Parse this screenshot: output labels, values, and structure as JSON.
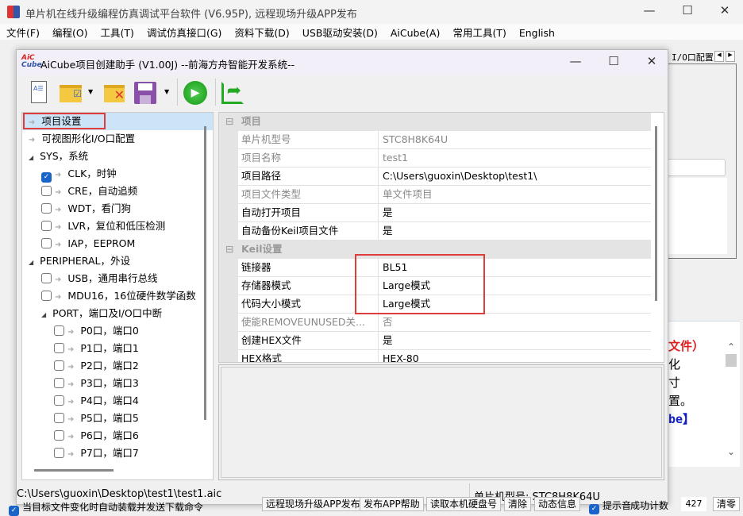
{
  "app": {
    "title": "单片机在线升级编程仿真调试平台软件 (V6.95P), 远程现场升级APP发布"
  },
  "menu": [
    "文件(F)",
    "编程(O)",
    "工具(T)",
    "调试仿真接口(G)",
    "资料下载(D)",
    "USB驱动安装(D)",
    "AiCube(A)",
    "常用工具(T)",
    "English"
  ],
  "right_panel": {
    "tab": "I/O口配置",
    "lines": [
      {
        "text": "文件）",
        "color": "#e02020"
      },
      {
        "text": "化",
        "color": "#000000"
      },
      {
        "text": "寸",
        "color": "#000000"
      },
      {
        "text": "置。",
        "color": "#000000"
      },
      {
        "text": "be】",
        "color": "#1020c0"
      }
    ]
  },
  "dialog": {
    "title": "AiCube项目创建助手 (V1.00J) --前海方舟智能开发系统--",
    "logo": "AiC Cube",
    "tree": [
      {
        "label": "项目设置",
        "level": 0,
        "kind": "leaf",
        "selected": true
      },
      {
        "label": "可视图形化I/O口配置",
        "level": 0,
        "kind": "leaf"
      },
      {
        "label": "SYS，系统",
        "level": 0,
        "kind": "group"
      },
      {
        "label": "CLK，时钟",
        "level": 1,
        "kind": "check",
        "checked": true
      },
      {
        "label": "CRE，自动追频",
        "level": 1,
        "kind": "check",
        "checked": false
      },
      {
        "label": "WDT，看门狗",
        "level": 1,
        "kind": "check",
        "checked": false
      },
      {
        "label": "LVR，复位和低压检测",
        "level": 1,
        "kind": "check",
        "checked": false
      },
      {
        "label": "IAP，EEPROM",
        "level": 1,
        "kind": "check",
        "checked": false
      },
      {
        "label": "PERIPHERAL，外设",
        "level": 0,
        "kind": "group"
      },
      {
        "label": "USB，通用串行总线",
        "level": 1,
        "kind": "check",
        "checked": false
      },
      {
        "label": "MDU16，16位硬件数学函数",
        "level": 1,
        "kind": "check",
        "checked": false
      },
      {
        "label": "PORT，端口及I/O口中断",
        "level": 1,
        "kind": "group"
      },
      {
        "label": "P0口，端口0",
        "level": 2,
        "kind": "check",
        "checked": false
      },
      {
        "label": "P1口，端口1",
        "level": 2,
        "kind": "check",
        "checked": false
      },
      {
        "label": "P2口，端口2",
        "level": 2,
        "kind": "check",
        "checked": false
      },
      {
        "label": "P3口，端口3",
        "level": 2,
        "kind": "check",
        "checked": false
      },
      {
        "label": "P4口，端口4",
        "level": 2,
        "kind": "check",
        "checked": false
      },
      {
        "label": "P5口，端口5",
        "level": 2,
        "kind": "check",
        "checked": false
      },
      {
        "label": "P6口，端口6",
        "level": 2,
        "kind": "check",
        "checked": false
      },
      {
        "label": "P7口，端口7",
        "level": 2,
        "kind": "check",
        "checked": false
      }
    ],
    "properties": [
      {
        "category": "项目"
      },
      {
        "name": "单片机型号",
        "value": "STC8H8K64U",
        "readonly": true
      },
      {
        "name": "项目名称",
        "value": "test1",
        "readonly": true
      },
      {
        "name": "项目路径",
        "value": "C:\\Users\\guoxin\\Desktop\\test1\\"
      },
      {
        "name": "项目文件类型",
        "value": "单文件项目",
        "readonly": true
      },
      {
        "name": "自动打开项目",
        "value": "是"
      },
      {
        "name": "自动备份Keil项目文件",
        "value": "是"
      },
      {
        "category": "Keil设置"
      },
      {
        "name": "链接器",
        "value": "BL51"
      },
      {
        "name": "存储器模式",
        "value": "Large模式"
      },
      {
        "name": "代码大小模式",
        "value": "Large模式"
      },
      {
        "name": "使能REMOVEUNUSED关...",
        "value": "否",
        "readonly": true
      },
      {
        "name": "创建HEX文件",
        "value": "是"
      },
      {
        "name": "HEX格式",
        "value": "HEX-80"
      }
    ],
    "status": {
      "path": "C:\\Users\\guoxin\\Desktop\\test1\\test1.aic",
      "mcu": "单片机型号:  STC8H8K64U"
    }
  },
  "bottom": {
    "auto_reload": "当目标文件变化时自动装载并发送下载命令",
    "buttons": [
      "远程现场升级APP发布",
      "发布APP帮助",
      "读取本机硬盘号",
      "清除",
      "动态信息"
    ],
    "beep": "提示音",
    "count_label": "成功计数",
    "count": "427",
    "clear": "清零"
  }
}
